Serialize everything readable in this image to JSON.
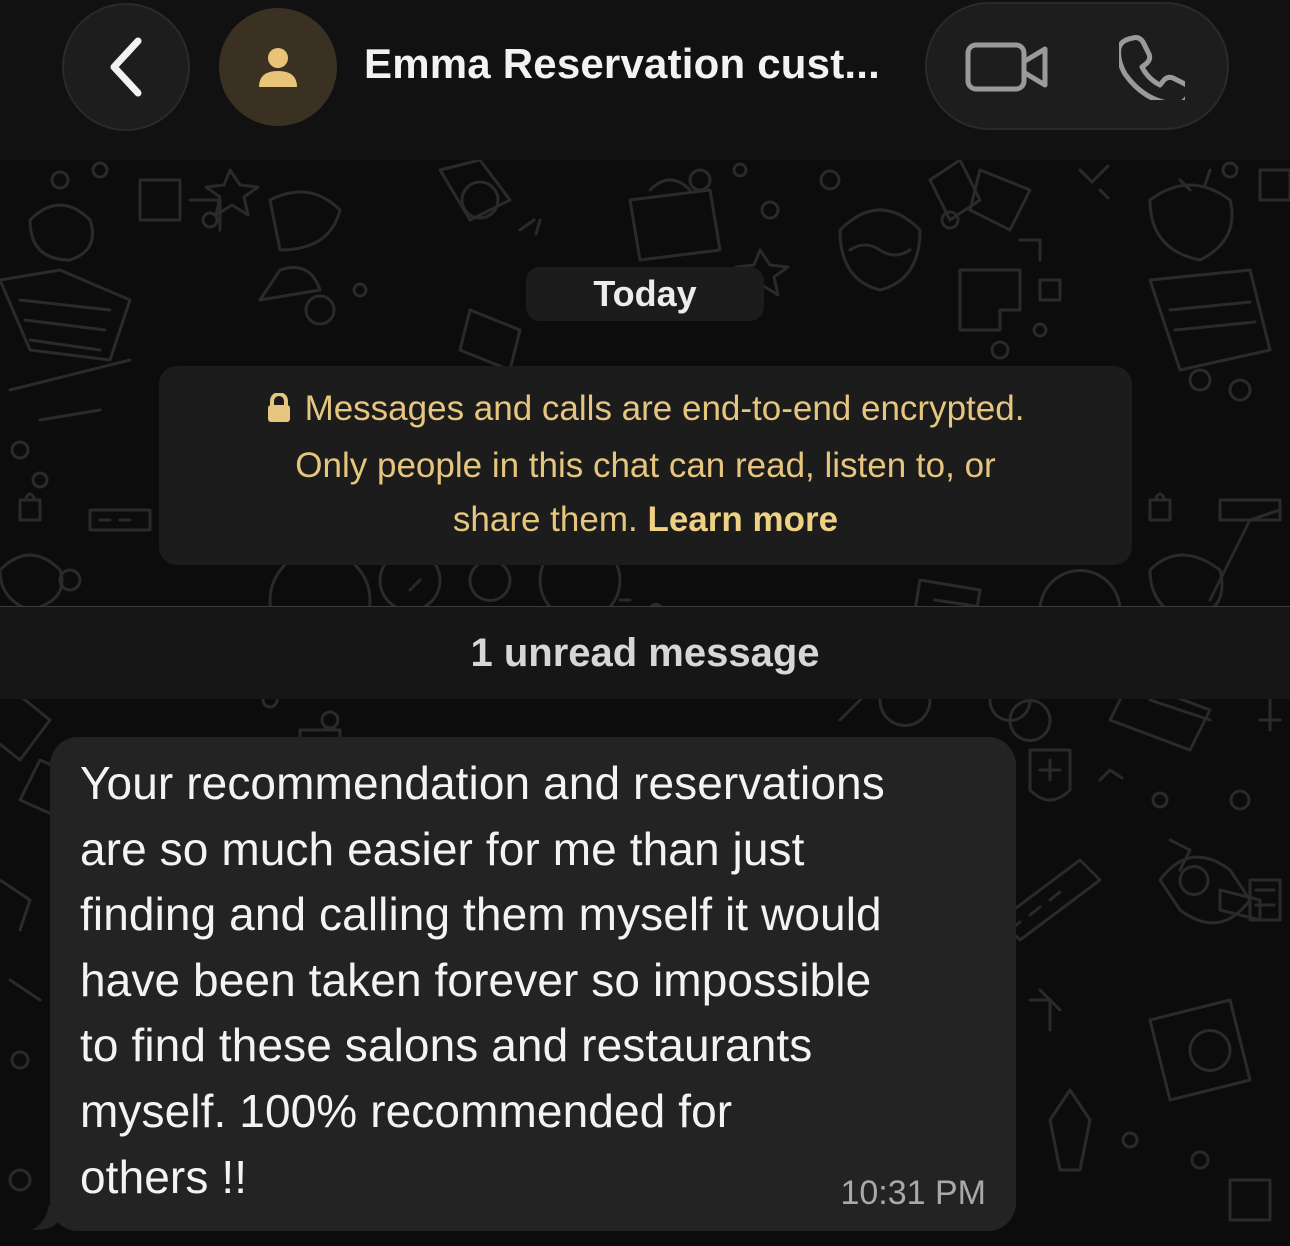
{
  "header": {
    "back_icon": "chevron-left-icon",
    "avatar_icon": "person-icon",
    "contact_name": "Emma Reservation cust...",
    "video_icon": "video-camera-icon",
    "phone_icon": "phone-icon"
  },
  "chat": {
    "date_chip": "Today",
    "encryption_notice": {
      "lock_icon": "lock-icon",
      "line1": "Messages and calls are end-to-end encrypted.",
      "line2": "Only people in this chat can read, listen to, or",
      "line3_text": "share them.",
      "learn_more": "Learn more"
    },
    "unread_divider": "1 unread message",
    "messages": [
      {
        "direction": "incoming",
        "text": "Your recommendation and reservations\nare so much easier for me than just\nfinding and calling them myself it would\nhave been taken forever so impossible\nto find these salons and restaurants\nmyself. 100% recommended for\nothers !!",
        "time": "10:31 PM"
      }
    ]
  },
  "colors": {
    "background": "#0c0c0c",
    "header_bg": "#111111",
    "bubble_bg": "#232323",
    "notice_text": "#e6c67f",
    "avatar_bg": "#3a3122",
    "avatar_fg": "#e8c476"
  }
}
